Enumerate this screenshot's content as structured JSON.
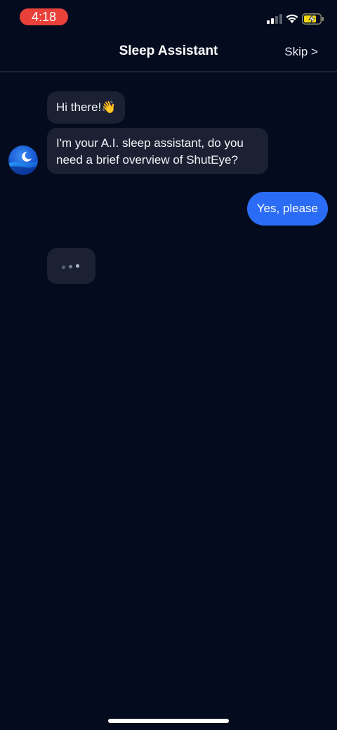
{
  "status_bar": {
    "time": "4:18",
    "signal_icon": "cellular-signal-icon",
    "wifi_icon": "wifi-icon",
    "battery_icon": "battery-charging-icon"
  },
  "header": {
    "title": "Sleep Assistant",
    "skip_label": "Skip >"
  },
  "chat": {
    "assistant_messages": [
      {
        "text": "Hi there!👋"
      },
      {
        "text": "I'm your A.I. sleep assistant, do you need a brief overview of ShutEye?"
      }
    ],
    "user_reply": "Yes, please",
    "typing_indicator": "typing-dots-icon",
    "avatar_icon": "moon-avatar-icon"
  },
  "colors": {
    "background": "#050b1e",
    "bubble": "#1b2133",
    "user_bubble": "#2b6cf6",
    "time_pill": "#e8413a"
  }
}
